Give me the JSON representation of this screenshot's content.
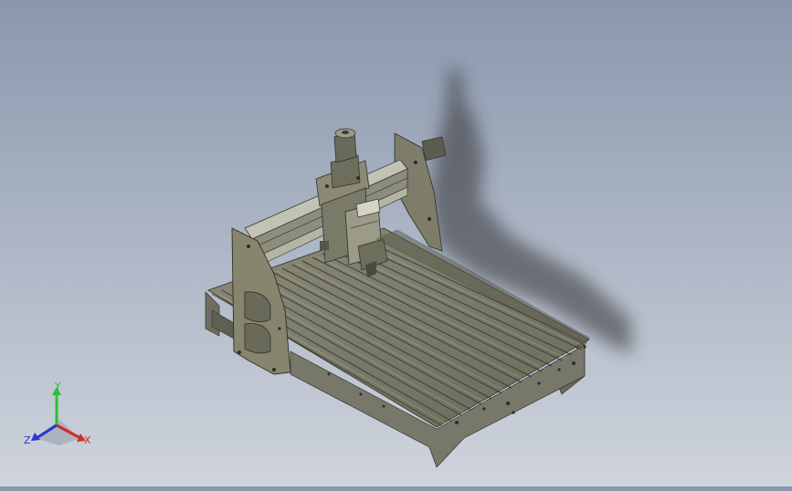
{
  "viewport": {
    "model": "cnc-router-assembly",
    "colors": {
      "background_top": "#8a97ad",
      "background_bottom": "#cfd4dc",
      "part_fill": "#7b7b69",
      "part_dark": "#4a4a40",
      "part_light": "#a3a38e",
      "shadow": "#3c3c3c"
    }
  },
  "triad": {
    "x_label": "X",
    "y_label": "Y",
    "z_label": "Z",
    "x_color": "#d22a2a",
    "y_color": "#2bbf3a",
    "z_color": "#2a35d2"
  }
}
